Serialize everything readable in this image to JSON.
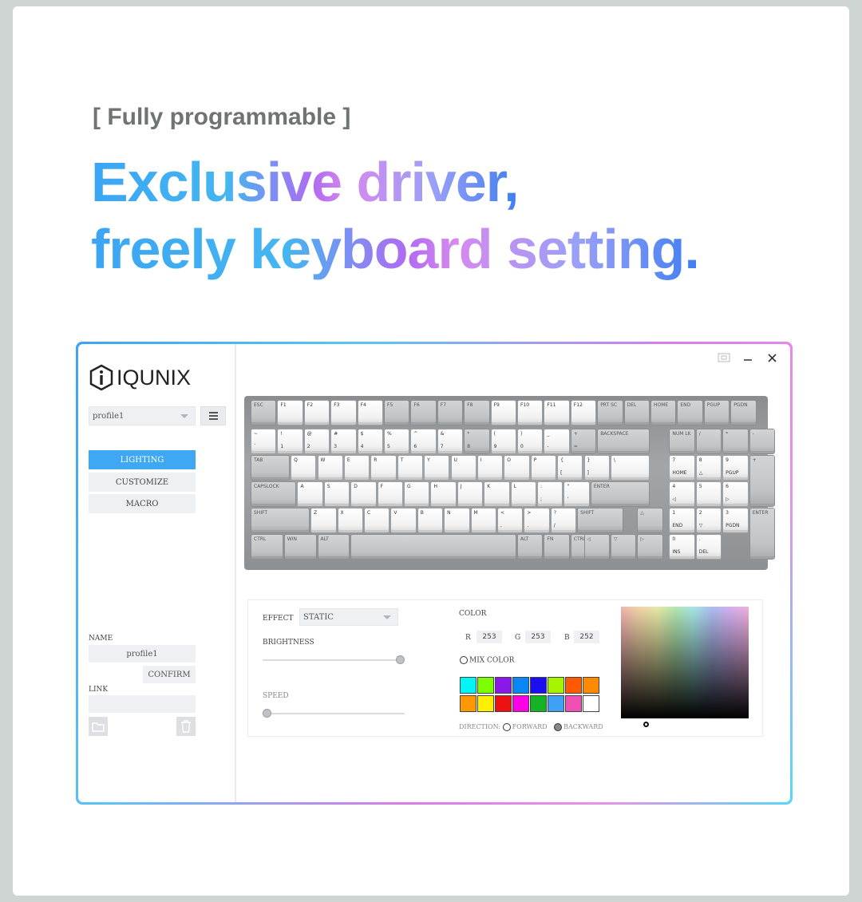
{
  "hero": {
    "kicker": "[ Fully programmable ]",
    "line1_a": "Exclusive ",
    "line1_b": "driver,",
    "line2_a": "freely ",
    "line2_b": "keyboard ",
    "line2_c": "setting."
  },
  "app": {
    "logo": "IQUNIX",
    "profile_select": "profile1",
    "nav": [
      {
        "label": "LIGHTING",
        "active": true
      },
      {
        "label": "CUSTOMIZE",
        "active": false
      },
      {
        "label": "MACRO",
        "active": false
      }
    ],
    "name_label": "NAME",
    "name_value": "profile1",
    "confirm_label": "CONFIRM",
    "link_label": "LINK",
    "link_value": ""
  },
  "window_controls": {
    "restore": "restore-icon",
    "minimize": "minimize-icon",
    "close": "close-icon"
  },
  "keyboard": {
    "rows": [
      [
        "ESC",
        "F1",
        "F2",
        "F3",
        "F4",
        "F5",
        "F6",
        "F7",
        "F8",
        "F9",
        "F10",
        "F11",
        "F12",
        "PRT SC",
        "DEL",
        "HOME",
        "END",
        "PGUP",
        "PGDN"
      ],
      [
        "~|`",
        "!|1",
        "@|2",
        "#|3",
        "$|4",
        "%|5",
        "^|6",
        "&|7",
        "*|8",
        "(|9",
        ")|0",
        "_|-",
        "+|=",
        "BACKSPACE",
        "NUM LK",
        "/",
        "*",
        "-"
      ],
      [
        "TAB",
        "Q",
        "W",
        "E",
        "R",
        "T",
        "Y",
        "U",
        "I",
        "O",
        "P",
        "{|[",
        "}|]",
        "\\||\\",
        "7|HOME",
        "8|△",
        "9|PGUP",
        "+"
      ],
      [
        "CAPSLOCK",
        "A",
        "S",
        "D",
        "F",
        "G",
        "H",
        "J",
        "K",
        "L",
        ":|;",
        "\"|'",
        "ENTER",
        "4|◁",
        "5",
        "6|▷"
      ],
      [
        "SHIFT",
        "Z",
        "X",
        "C",
        "V",
        "B",
        "N",
        "M",
        "<|,",
        ">|.",
        "?|/",
        "SHIFT",
        "△",
        "1|END",
        "2|▽",
        "3|PGDN",
        "ENTER"
      ],
      [
        "CTRL",
        "WIN",
        "ALT",
        "",
        "ALT",
        "FN",
        "CTRL",
        "◁",
        "▽",
        "▷",
        "0|INS",
        ".|DEL"
      ]
    ]
  },
  "lighting": {
    "effect_label": "EFFECT",
    "effect_value": "STATIC",
    "brightness_label": "BRIGHTNESS",
    "brightness_level": 1.0,
    "speed_label": "SPEED",
    "speed_level": 0.0,
    "color_label": "COLOR",
    "r_label": "R",
    "r_value": "253",
    "g_label": "G",
    "g_value": "253",
    "b_label": "B",
    "b_value": "252",
    "mix_color_label": "MIX COLOR",
    "swatches": [
      "#00f5f5",
      "#7dff00",
      "#8a18e8",
      "#0a86f5",
      "#1b0ef0",
      "#a6f500",
      "#ff5a00",
      "#ff8a00",
      "#ff9800",
      "#ffef00",
      "#ee1111",
      "#ff00e6",
      "#14b424",
      "#3da2f5",
      "#f050b4",
      "#ffffff"
    ],
    "direction_label": "DIRECTION:",
    "forward_label": "FORWARD",
    "backward_label": "BACKWARD"
  }
}
